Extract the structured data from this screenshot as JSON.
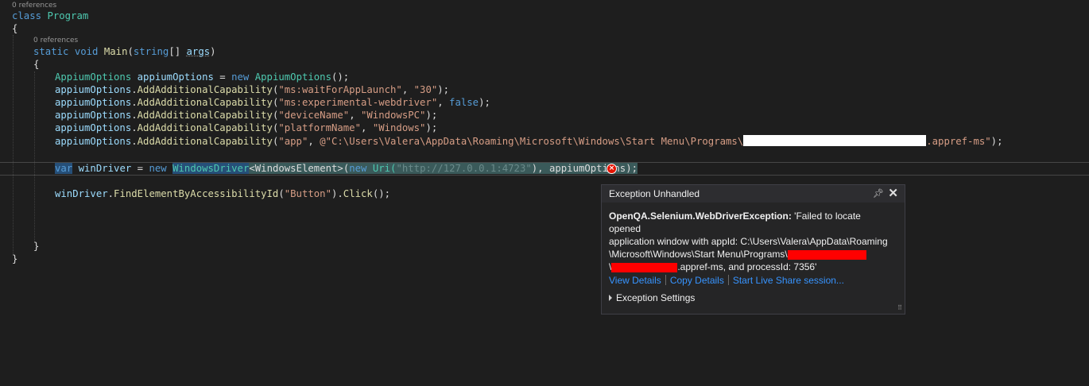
{
  "codelens": {
    "class_refs": "0 references",
    "main_refs": "0 references"
  },
  "code": {
    "class_kw": "class",
    "class_name": "Program",
    "open_brace": "{",
    "close_brace": "}",
    "static_kw": "static",
    "void_kw": "void",
    "main_name": "Main",
    "main_params_pre": "(",
    "string_kw": "string",
    "main_params_mid": "[] ",
    "args_name": "args",
    "main_params_post": ")",
    "l1_type": "AppiumOptions",
    "l1_var": " appiumOptions",
    "l1_eq": " = ",
    "l1_new": "new",
    "l1_ctor": " AppiumOptions",
    "l1_end": "();",
    "obj": "appiumOptions",
    "dot": ".",
    "method": "AddAdditionalCapability",
    "open_paren": "(",
    "comma": ", ",
    "close": ");",
    "cap1_key": "\"ms:waitForAppLaunch\"",
    "cap1_val": "\"30\"",
    "cap2_key": "\"ms:experimental-webdriver\"",
    "cap2_val": "false",
    "cap3_key": "\"deviceName\"",
    "cap3_val": "\"WindowsPC\"",
    "cap4_key": "\"platformName\"",
    "cap4_val": "\"Windows\"",
    "cap5_key": "\"app\"",
    "cap5_val_pre": "@\"C:\\Users\\Valera\\AppData\\Roaming\\Microsoft\\Windows\\Start Menu\\Programs\\",
    "cap5_val_post": ".appref-ms\"",
    "drv_var_kw": "var",
    "drv_name": " winDriver",
    "drv_eq": " = ",
    "drv_new": "new ",
    "drv_type": "WindowsDriver",
    "drv_generic": "<WindowsElement>(",
    "drv_new2": "new",
    "drv_uri": " Uri(",
    "drv_url": "\"http://127.0.0.1:4723\"",
    "drv_tail": "), appiumOptions);",
    "find_obj": "winDriver",
    "find_method": "FindElementByAccessibilityId",
    "find_arg": "\"Button\"",
    "find_tail": ").",
    "click_method": "Click",
    "click_tail": "();"
  },
  "exception": {
    "title": "Exception Unhandled",
    "type_name": "OpenQA.Selenium.WebDriverException:",
    "msg_line1": " 'Failed to locate opened",
    "msg_line2": "application window with appId: C:\\Users\\Valera\\AppData\\Roaming",
    "msg_line3": "\\Microsoft\\Windows\\Start Menu\\Programs\\",
    "msg_line4_pre": "\\",
    "msg_line4_post": ".appref-ms, and processId: 7356'",
    "link_view": "View Details",
    "link_copy": "Copy Details",
    "link_live": "Start Live Share session...",
    "settings": "Exception Settings",
    "error_glyph": "×"
  },
  "colors": {
    "background": "#1e1e1e",
    "keyword": "#569cd6",
    "type": "#4ec9b0",
    "string": "#d69d85",
    "method": "#dcdcaa",
    "link": "#3794ff",
    "error": "#e51400",
    "redaction": "#ff0000"
  },
  "icons": [
    "error-icon",
    "pin-icon",
    "close-icon",
    "expand-triangle-icon",
    "resize-grip-icon"
  ]
}
